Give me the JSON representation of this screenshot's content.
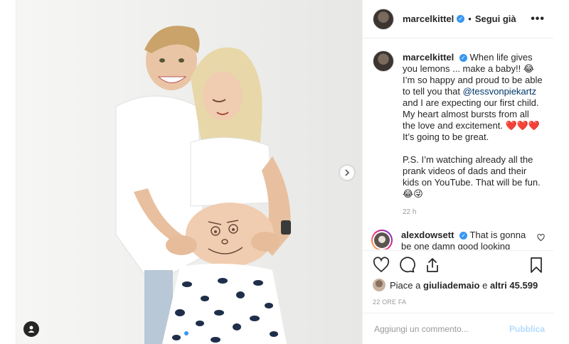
{
  "post": {
    "author": "marcelkittel",
    "follow_status": "Segui già",
    "more_label": "•••",
    "dot": "•",
    "verified_mark": "✓"
  },
  "caption": {
    "author": "marcelkittel",
    "text_part1": "When life gives you lemons ... make a baby!! 😂 I’m so happy and proud to be able to tell you that",
    "mention": "@tessvonpiekartz",
    "text_part2": "and I are expecting our first child. My heart almost bursts from all the love and excitement.",
    "hearts": "❤️❤️❤️",
    "text_part3": "It’s going to be great.",
    "text_ps": "P.S. I’m watching already all the prank videos of dads and their kids on YouTube. That will be fun. 😂😜",
    "time": "22 h"
  },
  "comments": [
    {
      "author": "alexdowsett",
      "text": "That is gonna be one damn good looking baby/child/adolescent/adult/pensioner"
    }
  ],
  "likes": {
    "prefix": "Piace a",
    "user": "giuliademaio",
    "middle": "e",
    "others": "altri 45.599"
  },
  "date_label": "22 ORE FA",
  "comment_box": {
    "placeholder": "Aggiungi un commento...",
    "publish_label": "Pubblica"
  },
  "icons": {
    "like": "heart-outline-icon",
    "comment": "speech-bubble-icon",
    "share": "share-icon",
    "save": "bookmark-icon",
    "next": "chevron-right-icon",
    "tag": "user-tag-icon"
  },
  "colors": {
    "accent": "#3897f0",
    "border": "#efefef",
    "muted": "#999999",
    "publish_disabled": "#b3dbff"
  },
  "carousel": {
    "total": 2,
    "active": 1
  }
}
